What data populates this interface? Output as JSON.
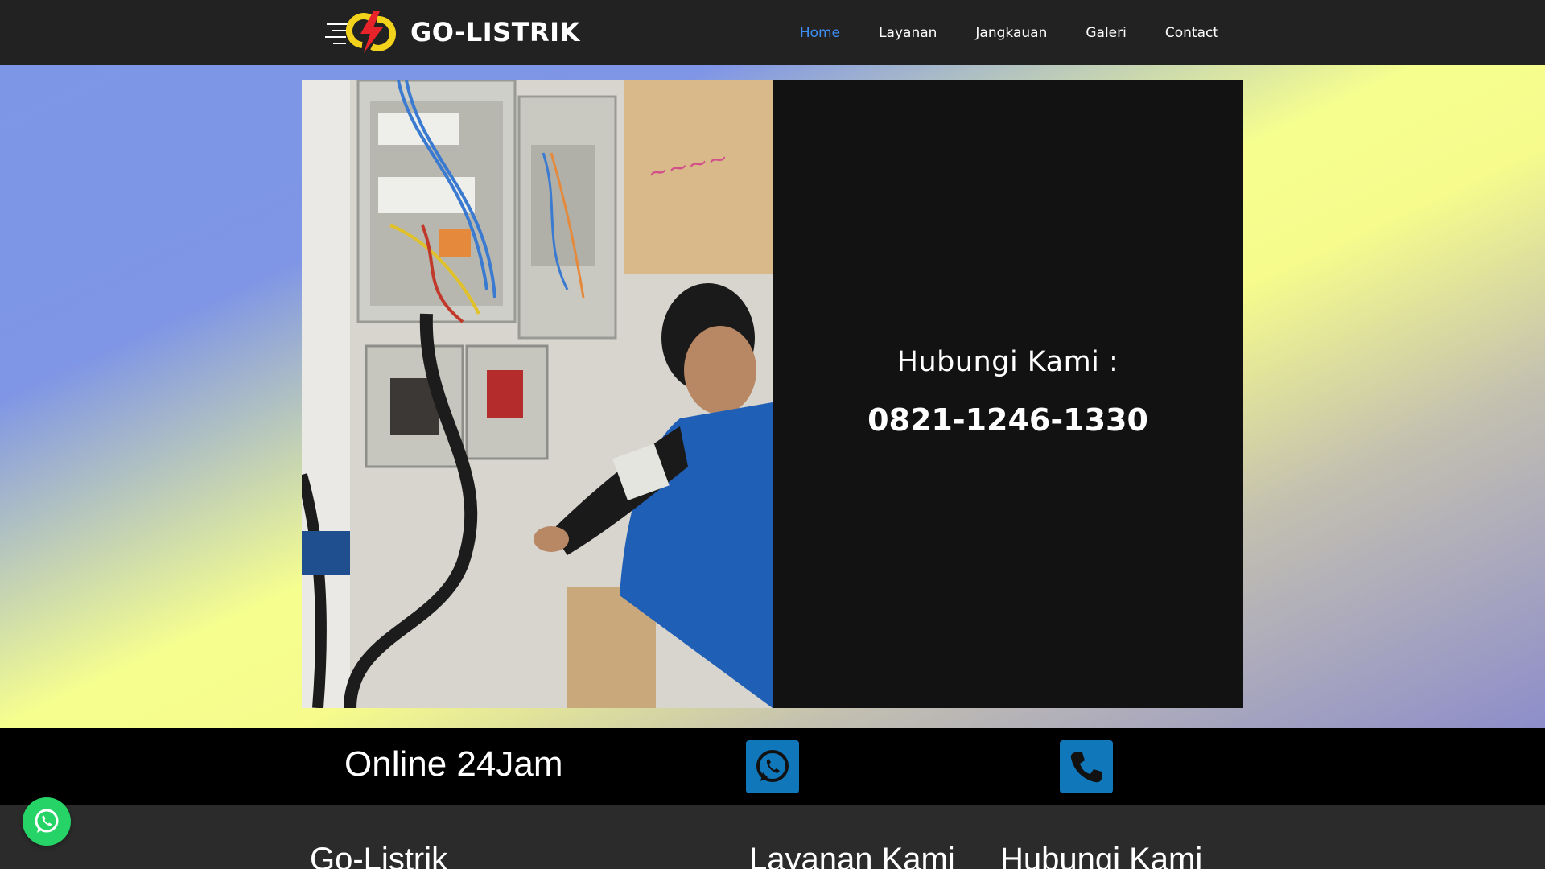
{
  "brand": {
    "name": "GO-LISTRIK",
    "logo_icon": "lightning-logo-icon"
  },
  "nav": {
    "items": [
      {
        "label": "Home",
        "active": true
      },
      {
        "label": "Layanan",
        "active": false
      },
      {
        "label": "Jangkauan",
        "active": false
      },
      {
        "label": "Galeri",
        "active": false
      },
      {
        "label": "Contact",
        "active": false
      }
    ],
    "active_color": "#3d8ef5"
  },
  "hero": {
    "photo_subject": "technician-working-on-electrical-panel",
    "contact_heading": "Hubungi Kami :",
    "phone": "0821-1246-1330"
  },
  "online_bar": {
    "text": "Online 24Jam",
    "whatsapp_icon": "whatsapp-icon",
    "phone_icon": "phone-icon",
    "button_color": "#1177bb"
  },
  "footer": {
    "col1_title": "Go-Listrik",
    "col2_title": "Layanan Kami",
    "col3_title": "Hubungi Kami"
  },
  "floating_whatsapp": {
    "icon": "whatsapp-icon",
    "color": "#25d366"
  }
}
